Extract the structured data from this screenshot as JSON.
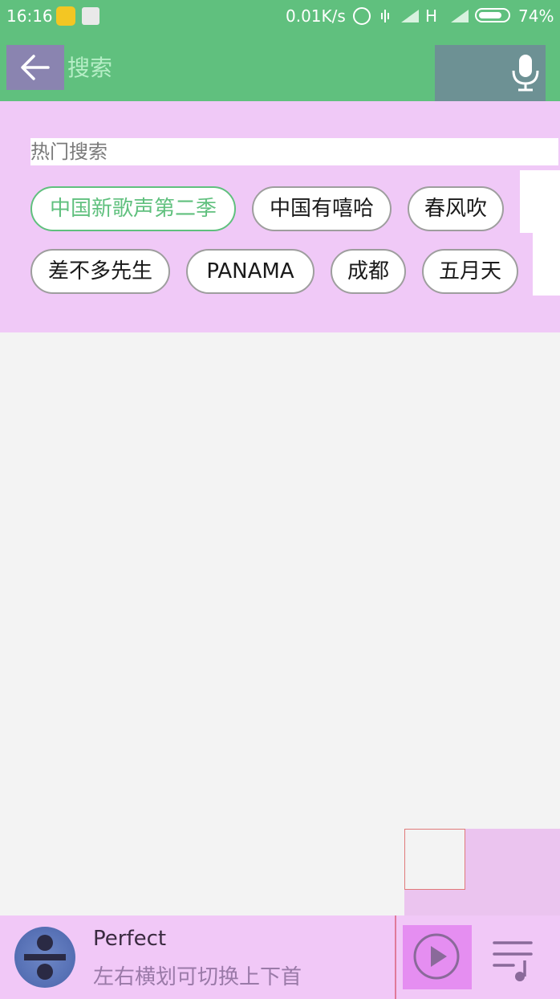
{
  "status_bar": {
    "time": "16:16",
    "net_speed": "0.01K/s",
    "network_type": "H",
    "battery": "74%",
    "icons": [
      "app-icon-yellow",
      "notification-icon",
      "alarm-icon",
      "vibrate-icon",
      "signal-icon",
      "signal-icon",
      "battery-icon"
    ]
  },
  "search": {
    "placeholder": "搜索",
    "back_icon": "back-arrow-icon",
    "voice_icon": "microphone-icon"
  },
  "hot_search": {
    "title": "热门搜索",
    "tags": [
      {
        "label": "中国新歌声第二季",
        "active": true
      },
      {
        "label": "中国有嘻哈",
        "active": false
      },
      {
        "label": "春风吹",
        "active": false
      },
      {
        "label": "差不多先生",
        "active": false
      },
      {
        "label": "PANAMA",
        "active": false
      },
      {
        "label": "成都",
        "active": false
      },
      {
        "label": "五月天",
        "active": false
      }
    ]
  },
  "player": {
    "song_title": "Perfect",
    "hint": "左右横划可切换上下首",
    "play_icon": "play-icon",
    "playlist_icon": "playlist-icon"
  },
  "colors": {
    "accent": "#60c07e",
    "panel": "#f0c9f7",
    "player": "#f1c8f7"
  }
}
